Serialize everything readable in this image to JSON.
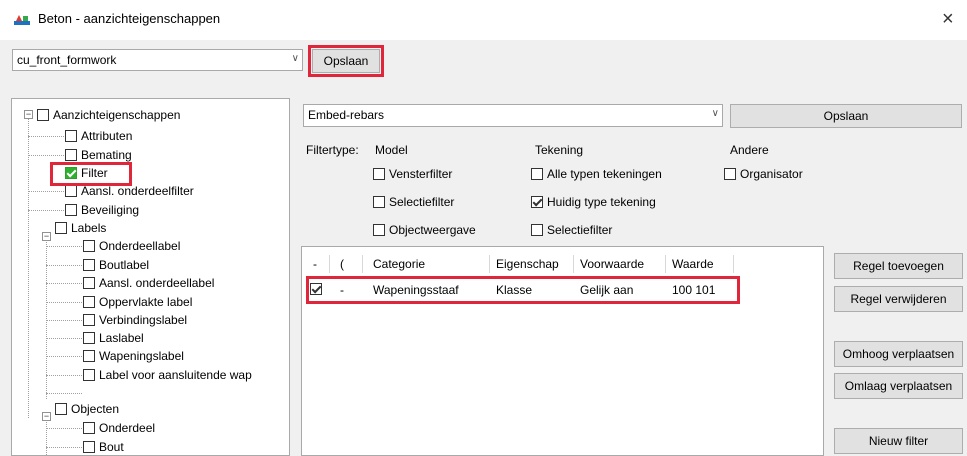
{
  "window": {
    "title": "Beton - aanzichteigenschappen",
    "close_glyph": "×"
  },
  "top": {
    "view_name": "cu_front_formwork",
    "save_label": "Opslaan"
  },
  "tree": {
    "items": [
      {
        "label": "Aanzichteigenschappen"
      },
      {
        "label": "Attributen"
      },
      {
        "label": "Bemating"
      },
      {
        "label": "Filter"
      },
      {
        "label": "Aansl. onderdeelfilter"
      },
      {
        "label": "Beveiliging"
      },
      {
        "label": "Labels"
      },
      {
        "label": "Onderdeellabel"
      },
      {
        "label": "Boutlabel"
      },
      {
        "label": "Aansl. onderdeellabel"
      },
      {
        "label": "Oppervlakte label"
      },
      {
        "label": "Verbindingslabel"
      },
      {
        "label": "Laslabel"
      },
      {
        "label": "Wapeningslabel"
      },
      {
        "label": "Label voor aansluitende wap"
      },
      {
        "label": "Objecten"
      },
      {
        "label": "Onderdeel"
      },
      {
        "label": "Bout"
      }
    ],
    "expand_glyph": "−"
  },
  "filter": {
    "name": "Embed-rebars",
    "save_label": "Opslaan",
    "filtertype_label": "Filtertype:",
    "group_model": "Model",
    "group_drawing": "Tekening",
    "group_other": "Andere",
    "options": {
      "window_filter": "Vensterfilter",
      "selection_filter": "Selectiefilter",
      "object_display": "Objectweergave",
      "all_drawing_types": "Alle typen tekeningen",
      "current_drawing_type": "Huidig type tekening",
      "drawing_selection_filter": "Selectiefilter",
      "organizer": "Organisator"
    }
  },
  "grid": {
    "headers": [
      "-",
      "(",
      "Categorie",
      "Eigenschap",
      "Voorwaarde",
      "Waarde"
    ],
    "row": {
      "dash": "-",
      "category": "Wapeningsstaaf",
      "property": "Klasse",
      "condition": "Gelijk aan",
      "value": "100 101"
    }
  },
  "side_buttons": {
    "add_row": "Regel toevoegen",
    "remove_row": "Regel verwijderen",
    "move_up": "Omhoog verplaatsen",
    "move_down": "Omlaag verplaatsen",
    "new_filter": "Nieuw filter"
  },
  "colors": {
    "highlight": "#e0263a",
    "check_green": "#2fb02f"
  }
}
